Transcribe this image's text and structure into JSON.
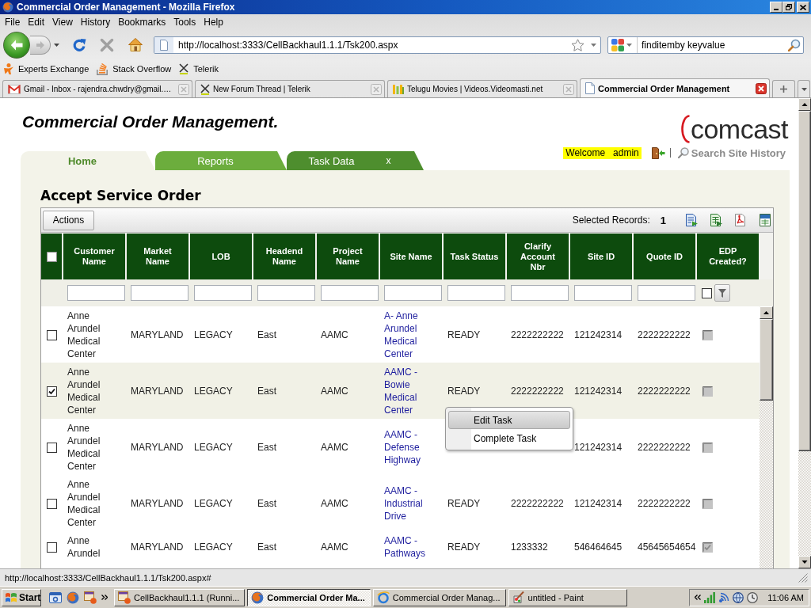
{
  "window": {
    "title": "Commercial Order Management - Mozilla Firefox"
  },
  "menu": [
    "File",
    "Edit",
    "View",
    "History",
    "Bookmarks",
    "Tools",
    "Help"
  ],
  "navigation": {
    "address": "http://localhost:3333/CellBackhaul1.1.1/Tsk200.aspx",
    "search": "finditemby keyvalue"
  },
  "bookmarks": [
    "Experts Exchange",
    "Stack Overflow",
    "Telerik"
  ],
  "browser_tabs": [
    {
      "label": "Gmail - Inbox - rajendra.chwdry@gmail.…",
      "selected": false
    },
    {
      "label": "New Forum Thread | Telerik",
      "selected": false
    },
    {
      "label": "Telugu Movies | Videos.Videomasti.net",
      "selected": false
    },
    {
      "label": "Commercial Order Management",
      "selected": true
    }
  ],
  "page": {
    "title": "Commercial Order Management.",
    "logo": "comcast",
    "welcome": "Welcome   admin",
    "search_link": "Search Site History",
    "tabs": [
      {
        "label": "Home",
        "selected": true,
        "color": "#f3f3e9"
      },
      {
        "label": "Reports",
        "selected": false,
        "color": "#6cad3d"
      },
      {
        "label": "Task Data",
        "selected": false,
        "color": "#4e8e2e",
        "close": "x"
      }
    ],
    "section_title": "Accept Service Order",
    "grid": {
      "actions": "Actions",
      "selected_label": "Selected Records:",
      "selected_count": "1",
      "select_all_checked": false,
      "edp_filter_checked": false,
      "columns": [
        {
          "label": "Customer Name",
          "kind": "text"
        },
        {
          "label": "Market Name",
          "kind": "text"
        },
        {
          "label": "LOB",
          "kind": "text"
        },
        {
          "label": "Headend Name",
          "kind": "text"
        },
        {
          "label": "Project Name",
          "kind": "text"
        },
        {
          "label": "Site Name",
          "kind": "link"
        },
        {
          "label": "Task Status",
          "kind": "text"
        },
        {
          "label": "Clarify Account Nbr",
          "kind": "text"
        },
        {
          "label": "Site ID",
          "kind": "text"
        },
        {
          "label": "Quote ID",
          "kind": "text"
        },
        {
          "label": "EDP Created?",
          "kind": "checkbox"
        }
      ],
      "rows": [
        {
          "checked": false,
          "selected": false,
          "edp_created": false,
          "cells": [
            "Anne Arundel Medical Center",
            "MARYLAND",
            "LEGACY",
            "East",
            "AAMC",
            "A- Anne Arundel Medical Center",
            "READY",
            "2222222222",
            "121242314",
            "2222222222"
          ]
        },
        {
          "checked": true,
          "selected": true,
          "edp_created": false,
          "cells": [
            "Anne Arundel Medical Center",
            "MARYLAND",
            "LEGACY",
            "East",
            "AAMC",
            "AAMC - Bowie Medical Center",
            "READY",
            "2222222222",
            "121242314",
            "2222222222"
          ]
        },
        {
          "checked": false,
          "selected": false,
          "edp_created": false,
          "cells": [
            "Anne Arundel Medical Center",
            "MARYLAND",
            "LEGACY",
            "East",
            "AAMC",
            "AAMC - Defense Highway",
            null,
            null,
            "121242314",
            "2222222222"
          ]
        },
        {
          "checked": false,
          "selected": false,
          "edp_created": false,
          "cells": [
            "Anne Arundel Medical Center",
            "MARYLAND",
            "LEGACY",
            "East",
            "AAMC",
            "AAMC - Industrial Drive",
            "READY",
            "2222222222",
            "121242314",
            "2222222222"
          ]
        },
        {
          "checked": false,
          "selected": false,
          "edp_created": true,
          "cells": [
            "Anne Arundel",
            "MARYLAND",
            "LEGACY",
            "East",
            "AAMC",
            "AAMC - Pathways",
            "READY",
            "1233332",
            "546464645",
            "45645654654"
          ]
        }
      ]
    },
    "context_menu": [
      {
        "label": "Edit Task",
        "selected": true
      },
      {
        "label": "Complete Task",
        "selected": false
      }
    ]
  },
  "status_bar": {
    "text": "http://localhost:3333/CellBackhaul1.1.1/Tsk200.aspx#"
  },
  "taskbar": {
    "start": "Start",
    "tasks": [
      {
        "label": "CellBackhaul1.1.1 (Runni...",
        "selected": false
      },
      {
        "label": "Commercial Order Ma...",
        "selected": true
      },
      {
        "label": "Commercial Order Manag...",
        "selected": false
      },
      {
        "label": "untitled - Paint",
        "selected": false
      }
    ],
    "clock": "11:06 AM"
  }
}
